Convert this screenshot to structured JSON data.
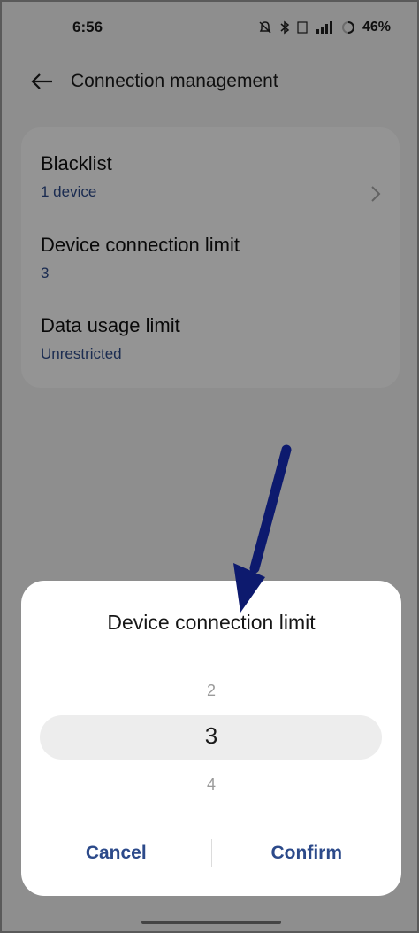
{
  "status_bar": {
    "time": "6:56",
    "battery": "46%"
  },
  "header": {
    "title": "Connection management"
  },
  "settings": {
    "items": [
      {
        "title": "Blacklist",
        "value": "1 device"
      },
      {
        "title": "Device connection limit",
        "value": "3"
      },
      {
        "title": "Data usage limit",
        "value": "Unrestricted"
      }
    ]
  },
  "dialog": {
    "title": "Device connection limit",
    "picker": {
      "previous": "2",
      "selected": "3",
      "next": "4"
    },
    "cancel_label": "Cancel",
    "confirm_label": "Confirm"
  },
  "colors": {
    "accent": "#2f4c8c",
    "annotation_arrow": "#0d1a6e"
  }
}
